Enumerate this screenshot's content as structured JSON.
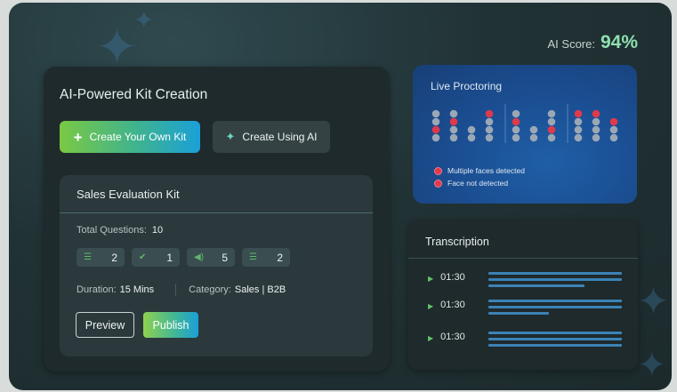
{
  "ai_score": {
    "label": "AI Score:",
    "value": "94%"
  },
  "kit_creation": {
    "title": "AI-Powered Kit Creation",
    "create_own_label": "Create Your Own Kit",
    "create_ai_label": "Create Using AI"
  },
  "kit": {
    "title": "Sales Evaluation Kit",
    "total_questions_label": "Total Questions:",
    "total_questions_value": "10",
    "chips": [
      {
        "icon": "list-icon",
        "count": "2"
      },
      {
        "icon": "check-doc-icon",
        "count": "1"
      },
      {
        "icon": "audio-icon",
        "count": "5"
      },
      {
        "icon": "list-icon",
        "count": "2"
      }
    ],
    "duration_label": "Duration:",
    "duration_value": "15 Mins",
    "category_label": "Category:",
    "category_value": "Sales | B2B",
    "preview_label": "Preview",
    "publish_label": "Publish"
  },
  "proctoring": {
    "title": "Live Proctoring",
    "legend": [
      "Multiple faces detected",
      "Face not detected"
    ],
    "colors": {
      "normal": "#9aa7b5",
      "alert": "#e0394b"
    }
  },
  "transcription": {
    "title": "Transcription",
    "rows": [
      {
        "time": "01:30"
      },
      {
        "time": "01:30"
      },
      {
        "time": "01:30"
      }
    ]
  }
}
